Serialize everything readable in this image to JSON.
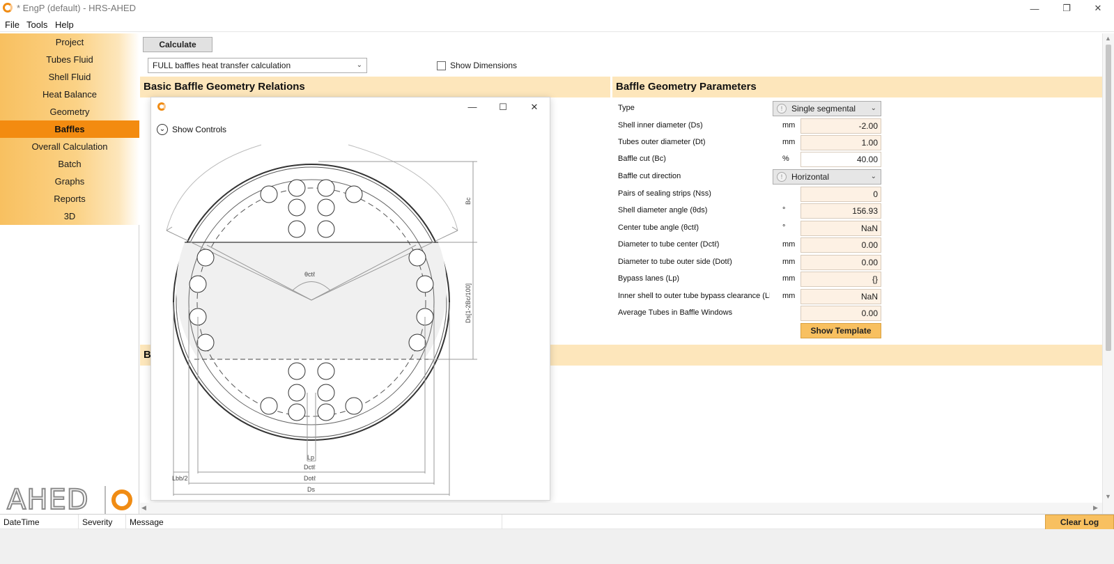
{
  "window": {
    "title": "* EngP (default) - HRS-AHED",
    "minimize_glyph": "—",
    "maximize_glyph": "❐",
    "close_glyph": "✕"
  },
  "menu": [
    "File",
    "Tools",
    "Help"
  ],
  "sidebar": {
    "items": [
      {
        "label": "Project",
        "active": false
      },
      {
        "label": "Tubes Fluid",
        "active": false
      },
      {
        "label": "Shell Fluid",
        "active": false
      },
      {
        "label": "Heat Balance",
        "active": false
      },
      {
        "label": "Geometry",
        "active": false
      },
      {
        "label": "Baffles",
        "active": true
      },
      {
        "label": "Overall Calculation",
        "active": false
      },
      {
        "label": "Batch",
        "active": false
      },
      {
        "label": "Graphs",
        "active": false
      },
      {
        "label": "Reports",
        "active": false
      },
      {
        "label": "3D",
        "active": false
      }
    ],
    "brand": "AHED"
  },
  "toolbar": {
    "calculate_label": "Calculate",
    "mode_value": "FULL baffles heat transfer calculation",
    "show_dimensions_label": "Show Dimensions",
    "show_dimensions_checked": false
  },
  "sections": {
    "basic": "Basic Baffle Geometry Relations",
    "params": "Baffle Geometry Parameters",
    "third_partial": "B"
  },
  "params": {
    "type": {
      "label": "Type",
      "value": "Single segmental"
    },
    "ds": {
      "label": "Shell inner diameter (Ds)",
      "unit": "mm",
      "value": "-2.00"
    },
    "dt": {
      "label": "Tubes outer diameter (Dt)",
      "unit": "mm",
      "value": "1.00"
    },
    "bc": {
      "label": "Baffle cut  (Bc)",
      "unit": "%",
      "value": "40.00"
    },
    "cut_dir": {
      "label": "Baffle cut direction",
      "value": "Horizontal"
    },
    "nss": {
      "label": "Pairs of sealing strips (Nss)",
      "unit": "",
      "value": "0"
    },
    "theta_ds": {
      "label": "Shell diameter angle (θds)",
      "unit": "°",
      "value": "156.93"
    },
    "theta_ctl": {
      "label": "Center tube angle (θctℓ)",
      "unit": "°",
      "value": "NaN"
    },
    "dctl": {
      "label": "Diameter to tube center (Dctℓ)",
      "unit": "mm",
      "value": "0.00"
    },
    "dotl": {
      "label": "Diameter to tube outer side (Dotℓ)",
      "unit": "mm",
      "value": "0.00"
    },
    "lp": {
      "label": "Bypass lanes (Lp)",
      "unit": "mm",
      "value": "{}"
    },
    "lbb": {
      "label": "Inner shell to outer tube bypass clearance (Lbb)",
      "unit": "mm",
      "value": "NaN"
    },
    "avg_tubes": {
      "label": "Average Tubes in Baffle Windows",
      "unit": "",
      "value": "0.00"
    },
    "template_label": "Show Template"
  },
  "popup": {
    "controls_label": "Show Controls",
    "expand_glyph": "⌄",
    "min_glyph": "—",
    "max_glyph": "☐",
    "close_glyph": "✕",
    "drawing_labels": {
      "bc": "Bc",
      "ds_formula": "Ds[1-2Bc/100]",
      "theta": "θctℓ",
      "lp": "Lp",
      "dctl": "Dctℓ",
      "dotl": "Dotℓ",
      "lbb": "Lbb/2",
      "ds": "Ds"
    }
  },
  "log": {
    "columns": [
      "DateTime",
      "Severity",
      "Message"
    ],
    "clear_label": "Clear Log"
  },
  "colors": {
    "accent": "#f38b10",
    "header_bg": "#fde6bb",
    "field_bg": "#fdf1e4",
    "button_orange": "#f8c060"
  }
}
